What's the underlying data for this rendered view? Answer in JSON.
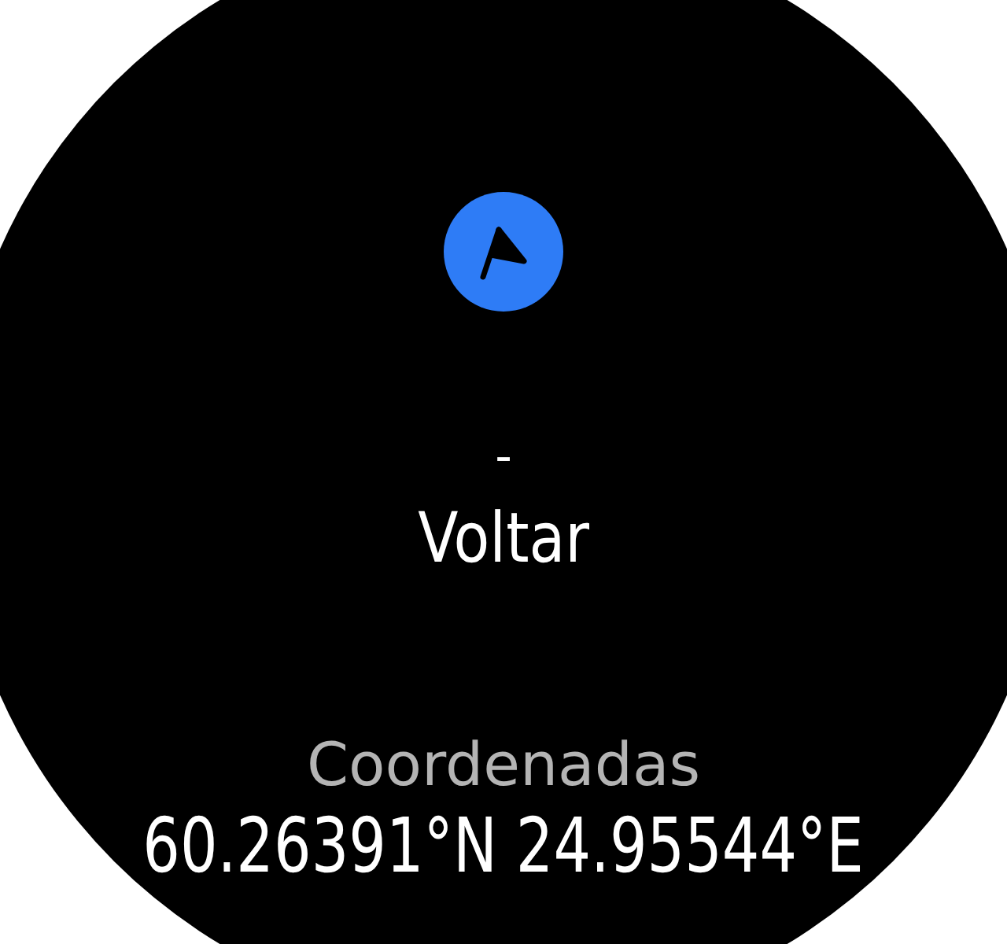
{
  "screen": {
    "separator": "-",
    "title": "Voltar"
  },
  "coordinates": {
    "label": "Coordenadas",
    "value": "60.26391°N 24.95544°E"
  }
}
